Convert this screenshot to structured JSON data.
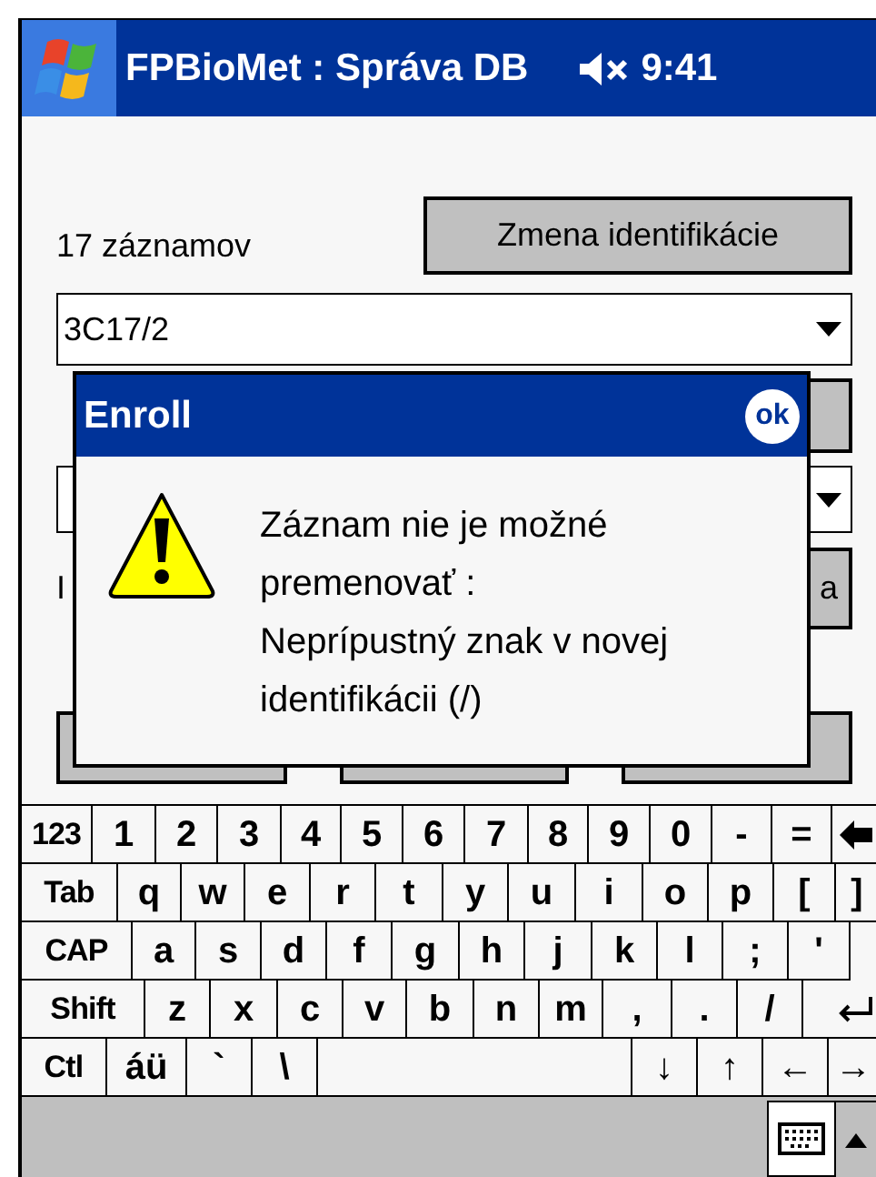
{
  "status_bar": {
    "title": "FPBioMet : Správa DB",
    "volume_muted": true,
    "time": "9:41"
  },
  "form": {
    "record_count": "17 záznamov",
    "rename_button": "Zmena identifikácie",
    "record_dropdown": {
      "value": "3C17/2"
    },
    "label_2": "I",
    "button_2": "a"
  },
  "dialog": {
    "title": "Enroll",
    "ok": "ok",
    "message_lines": [
      "Záznam nie je možné",
      "premenovať :",
      "Neprípustný znak v novej",
      "identifikácii (/)"
    ]
  },
  "keyboard": {
    "number_row": [
      {
        "label": "123"
      },
      {
        "label": "1"
      },
      {
        "label": "2"
      },
      {
        "label": "3"
      },
      {
        "label": "4"
      },
      {
        "label": "5"
      },
      {
        "label": "6"
      },
      {
        "label": "7"
      },
      {
        "label": "8"
      },
      {
        "label": "9"
      },
      {
        "label": "0"
      },
      {
        "label": "-"
      },
      {
        "label": "="
      },
      {
        "kind": "backspace"
      }
    ],
    "top_row": [
      {
        "label": "Tab"
      },
      {
        "label": "q"
      },
      {
        "label": "w"
      },
      {
        "label": "e"
      },
      {
        "label": "r"
      },
      {
        "label": "t"
      },
      {
        "label": "y"
      },
      {
        "label": "u"
      },
      {
        "label": "i"
      },
      {
        "label": "o"
      },
      {
        "label": "p"
      },
      {
        "label": "["
      },
      {
        "label": "]"
      }
    ],
    "home_row": [
      {
        "label": "CAP"
      },
      {
        "label": "a"
      },
      {
        "label": "s"
      },
      {
        "label": "d"
      },
      {
        "label": "f"
      },
      {
        "label": "g"
      },
      {
        "label": "h"
      },
      {
        "label": "j"
      },
      {
        "label": "k"
      },
      {
        "label": "l"
      },
      {
        "label": ";"
      },
      {
        "label": "'"
      }
    ],
    "bottom_row": [
      {
        "label": "Shift"
      },
      {
        "label": "z"
      },
      {
        "label": "x"
      },
      {
        "label": "c"
      },
      {
        "label": "v"
      },
      {
        "label": "b"
      },
      {
        "label": "n"
      },
      {
        "label": "m"
      },
      {
        "label": ","
      },
      {
        "label": "."
      },
      {
        "label": "/"
      },
      {
        "kind": "enter"
      }
    ],
    "control_keys": [
      {
        "label": "Ctl"
      },
      {
        "label": "áü"
      },
      {
        "label": "`"
      },
      {
        "label": "\\"
      }
    ],
    "arrow_keys": [
      {
        "label": "↓"
      },
      {
        "label": "↑"
      },
      {
        "label": "←"
      },
      {
        "label": "→"
      }
    ]
  }
}
